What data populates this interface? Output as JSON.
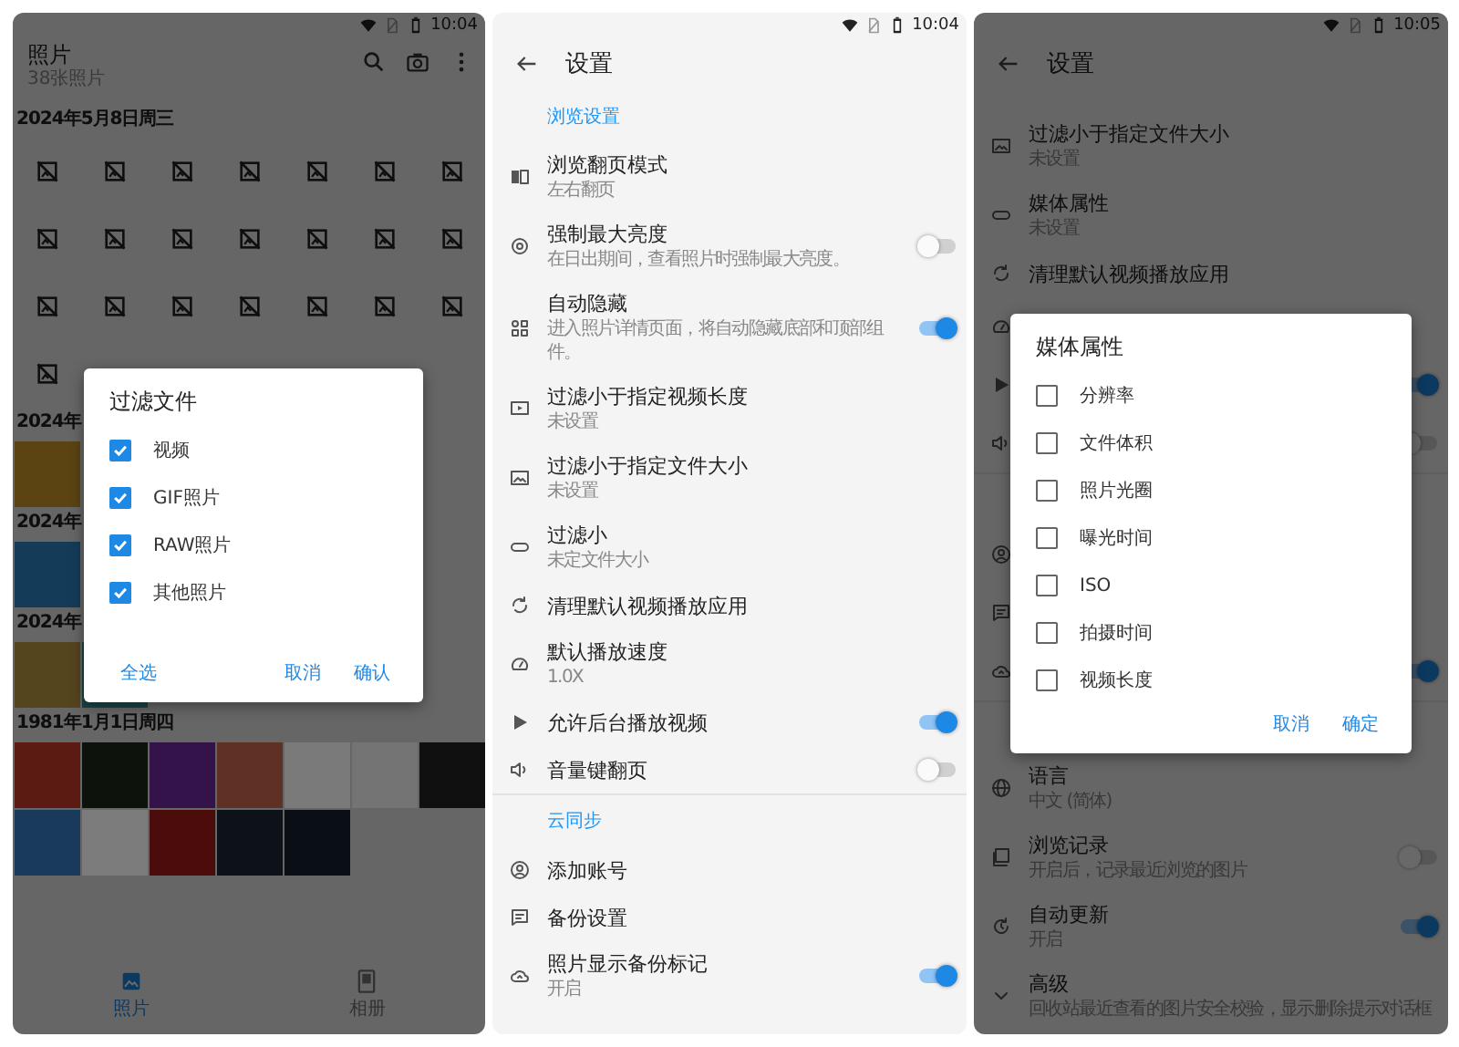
{
  "panels": [
    {
      "kind": "gallery",
      "status": {
        "time": "10:04"
      },
      "title": "照片",
      "subtitle": "38张照片",
      "groups": [
        {
          "date": "2024年5月8日周三",
          "thumbs": [
            {
              "kind": "broken"
            },
            {
              "kind": "broken"
            },
            {
              "kind": "broken"
            },
            {
              "kind": "broken"
            },
            {
              "kind": "broken"
            },
            {
              "kind": "broken"
            },
            {
              "kind": "broken"
            },
            {
              "kind": "broken"
            },
            {
              "kind": "broken"
            },
            {
              "kind": "broken"
            },
            {
              "kind": "broken"
            },
            {
              "kind": "broken"
            },
            {
              "kind": "broken"
            },
            {
              "kind": "broken"
            },
            {
              "kind": "broken"
            },
            {
              "kind": "broken"
            },
            {
              "kind": "broken"
            },
            {
              "kind": "broken"
            },
            {
              "kind": "broken"
            },
            {
              "kind": "broken"
            },
            {
              "kind": "broken"
            },
            {
              "kind": "broken"
            }
          ]
        },
        {
          "date": "2024年",
          "thumbs": [
            {
              "kind": "image",
              "color": "#5b4412"
            }
          ]
        },
        {
          "date": "2024年",
          "thumbs": [
            {
              "kind": "image",
              "color": "#143c58"
            }
          ]
        },
        {
          "date": "2024年",
          "thumbs": [
            {
              "kind": "image",
              "color": "#54451e"
            },
            {
              "kind": "image",
              "color": "#1a4343"
            }
          ]
        },
        {
          "date": "1981年1月1日周四",
          "thumbs": [
            {
              "kind": "image",
              "color": "#5b1b12"
            },
            {
              "kind": "image",
              "color": "#0d120d"
            },
            {
              "kind": "image",
              "color": "#34134b"
            },
            {
              "kind": "image",
              "color": "#5e3124"
            },
            {
              "kind": "image",
              "color": "#7a7a7a"
            },
            {
              "kind": "image",
              "color": "#747474"
            },
            {
              "kind": "image",
              "color": "#101010"
            },
            {
              "kind": "image",
              "color": "#193a5a"
            },
            {
              "kind": "image",
              "color": "#7c7c7c"
            },
            {
              "kind": "image",
              "color": "#4d0c0c"
            },
            {
              "kind": "image",
              "color": "#0c1218"
            },
            {
              "kind": "image",
              "color": "#0a0e15"
            }
          ]
        }
      ],
      "nav": [
        {
          "label": "照片",
          "selected": true
        },
        {
          "label": "相册",
          "selected": false
        }
      ],
      "dialog": {
        "title": "过滤文件",
        "options": [
          {
            "label": "视频",
            "checked": true
          },
          {
            "label": "GIF照片",
            "checked": true
          },
          {
            "label": "RAW照片",
            "checked": true
          },
          {
            "label": "其他照片",
            "checked": true
          }
        ],
        "buttons": [
          {
            "label": "全选",
            "kind": "start"
          },
          {
            "label": "取消",
            "kind": "end"
          },
          {
            "label": "确认",
            "kind": "end"
          }
        ]
      }
    },
    {
      "kind": "settings",
      "status": {
        "time": "10:04"
      },
      "title": "设置",
      "rows": [
        {
          "kind": "section",
          "title": "浏览设置"
        },
        {
          "kind": "item",
          "title": "浏览翻页模式",
          "subtitle": "左右翻页"
        },
        {
          "kind": "switch",
          "title": "强制最大亮度",
          "subtitle": "在日出期间，查看照片时强制最大亮度。",
          "on": false
        },
        {
          "kind": "switch",
          "title": "自动隐藏",
          "subtitle": "进入照片详情页面，将自动隐藏底部和顶部组件。",
          "on": true
        },
        {
          "kind": "item",
          "title": "过滤小于指定视频长度",
          "subtitle": "未设置"
        },
        {
          "kind": "item",
          "title": "过滤小于指定文件大小",
          "subtitle": "未设置"
        },
        {
          "kind": "item",
          "title": "过滤小",
          "subtitle": "未定文件大小"
        },
        {
          "kind": "item",
          "title": "清理默认视频播放应用"
        },
        {
          "kind": "item",
          "title": "默认播放速度",
          "subtitle": "1.0X"
        },
        {
          "kind": "switch",
          "title": "允许后台播放视频",
          "on": true
        },
        {
          "kind": "switch",
          "title": "音量键翻页",
          "on": false
        },
        {
          "kind": "section",
          "title": "云同步"
        },
        {
          "kind": "item",
          "title": "添加账号"
        },
        {
          "kind": "item",
          "title": "备份设置"
        },
        {
          "kind": "switch",
          "title": "照片显示备份标记",
          "subtitle": "开启",
          "on": true
        }
      ]
    },
    {
      "kind": "settings",
      "status": {
        "time": "10:05"
      },
      "title": "设置",
      "rows": [
        {
          "kind": "item",
          "title": "过滤小于指定文件大小",
          "subtitle": "未设置"
        },
        {
          "kind": "item",
          "title": "媒体属性",
          "subtitle": "未设置"
        },
        {
          "kind": "item",
          "title": "清理默认视频播放应用"
        },
        {
          "kind": "item"
        },
        {
          "kind": "switch",
          "on": true
        },
        {
          "kind": "switch",
          "on": false
        },
        {
          "kind": "section"
        },
        {
          "kind": "item"
        },
        {
          "kind": "item"
        },
        {
          "kind": "switch",
          "on": true
        },
        {
          "kind": "section"
        },
        {
          "kind": "item",
          "title": "语言",
          "subtitle": "中文 (简体)"
        },
        {
          "kind": "switch",
          "title": "浏览记录",
          "subtitle": "开启后，记录最近浏览的图片",
          "on": false
        },
        {
          "kind": "switch",
          "title": "自动更新",
          "subtitle": "开启",
          "on": true
        },
        {
          "kind": "item",
          "title": "高级",
          "subtitle": "回收站最近查看的图片安全校验，显示删除提示对话框"
        }
      ],
      "dialog": {
        "title": "媒体属性",
        "options": [
          {
            "label": "分辨率",
            "checked": false
          },
          {
            "label": "文件体积",
            "checked": false
          },
          {
            "label": "照片光圈",
            "checked": false
          },
          {
            "label": "曝光时间",
            "checked": false
          },
          {
            "label": "ISO",
            "checked": false
          },
          {
            "label": "拍摄时间",
            "checked": false
          },
          {
            "label": "视频长度",
            "checked": false
          }
        ],
        "buttons": [
          {
            "label": "取消",
            "kind": "end"
          },
          {
            "label": "确定",
            "kind": "end"
          }
        ]
      }
    }
  ]
}
